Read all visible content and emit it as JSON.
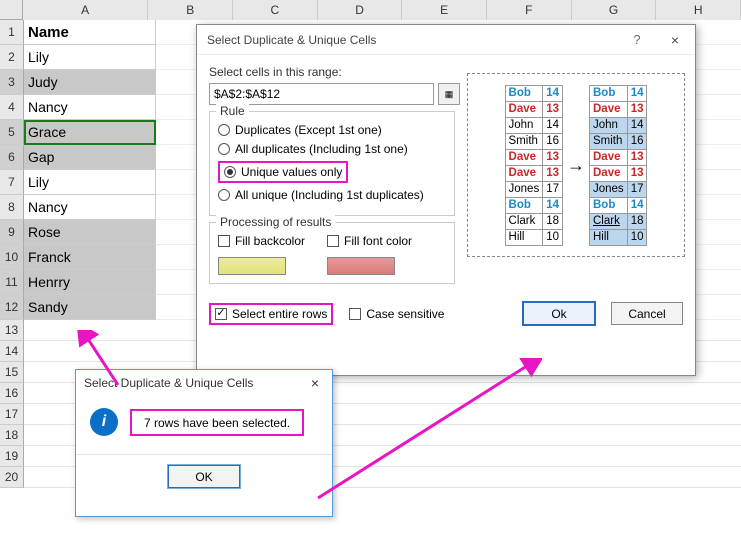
{
  "columns": [
    "A",
    "B",
    "C",
    "D",
    "E",
    "F",
    "G",
    "H"
  ],
  "row_nums": [
    "1",
    "2",
    "3",
    "4",
    "5",
    "6",
    "7",
    "8",
    "9",
    "10",
    "11",
    "12",
    "13",
    "14",
    "15",
    "16",
    "17",
    "18",
    "19",
    "20"
  ],
  "cells": {
    "a": [
      "Name",
      "Lily",
      "Judy",
      "Nancy",
      "Grace",
      "Gap",
      "Lily",
      "Nancy",
      "Rose",
      "Franck",
      "Henrry",
      "Sandy"
    ]
  },
  "shaded_rows": [
    3,
    5,
    6,
    9,
    10,
    11,
    12
  ],
  "active_row": 5,
  "dialog": {
    "title": "Select Duplicate & Unique Cells",
    "help": "?",
    "close": "×",
    "select_label": "Select cells in this range:",
    "range_value": "$A$2:$A$12",
    "rule_legend": "Rule",
    "rules": {
      "dup_except": "Duplicates (Except 1st one)",
      "all_dup": "All duplicates (Including 1st one)",
      "unique_only": "Unique values only",
      "all_unique": "All unique (Including 1st duplicates)"
    },
    "proc_legend": "Processing of results",
    "fill_backcolor": "Fill backcolor",
    "fill_fontcolor": "Fill font color",
    "select_entire_rows": "Select entire rows",
    "case_sensitive": "Case sensitive",
    "ok": "Ok",
    "cancel": "Cancel"
  },
  "example": {
    "arrow": "→",
    "left": [
      {
        "name": "Bob",
        "v": "14",
        "cls": "bob"
      },
      {
        "name": "Dave",
        "v": "13",
        "cls": "dave"
      },
      {
        "name": "John",
        "v": "14",
        "cls": ""
      },
      {
        "name": "Smith",
        "v": "16",
        "cls": ""
      },
      {
        "name": "Dave",
        "v": "13",
        "cls": "dave"
      },
      {
        "name": "Dave",
        "v": "13",
        "cls": "dave"
      },
      {
        "name": "Jones",
        "v": "17",
        "cls": ""
      },
      {
        "name": "Bob",
        "v": "14",
        "cls": "bob"
      },
      {
        "name": "Clark",
        "v": "18",
        "cls": ""
      },
      {
        "name": "Hill",
        "v": "10",
        "cls": ""
      }
    ],
    "right": [
      {
        "name": "Bob",
        "v": "14",
        "cls": "bob",
        "sel": false
      },
      {
        "name": "Dave",
        "v": "13",
        "cls": "dave",
        "sel": false
      },
      {
        "name": "John",
        "v": "14",
        "cls": "",
        "sel": true
      },
      {
        "name": "Smith",
        "v": "16",
        "cls": "",
        "sel": true
      },
      {
        "name": "Dave",
        "v": "13",
        "cls": "dave",
        "sel": false
      },
      {
        "name": "Dave",
        "v": "13",
        "cls": "dave",
        "sel": false
      },
      {
        "name": "Jones",
        "v": "17",
        "cls": "",
        "sel": true
      },
      {
        "name": "Bob",
        "v": "14",
        "cls": "bob",
        "sel": false
      },
      {
        "name": "Clark",
        "v": "18",
        "cls": "clark",
        "sel": true
      },
      {
        "name": "Hill",
        "v": "10",
        "cls": "",
        "sel": true
      }
    ]
  },
  "dialog2": {
    "title": "Select Duplicate & Unique Cells",
    "close": "×",
    "info": "i",
    "message": "7 rows have been selected.",
    "ok": "OK"
  }
}
